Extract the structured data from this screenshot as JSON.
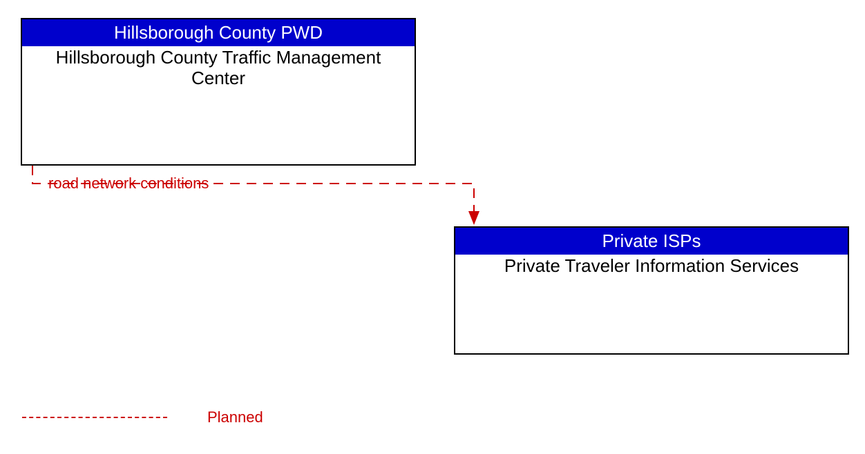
{
  "entities": {
    "source": {
      "header": "Hillsborough County PWD",
      "body": "Hillsborough County Traffic Management Center"
    },
    "target": {
      "header": "Private ISPs",
      "body": "Private Traveler Information Services"
    }
  },
  "flow": {
    "label": "road network conditions",
    "status": "Planned"
  },
  "legend": {
    "planned": "Planned"
  },
  "colors": {
    "header_bg": "#0000cc",
    "header_fg": "#ffffff",
    "planned_line": "#cc0000",
    "box_border": "#000000"
  }
}
